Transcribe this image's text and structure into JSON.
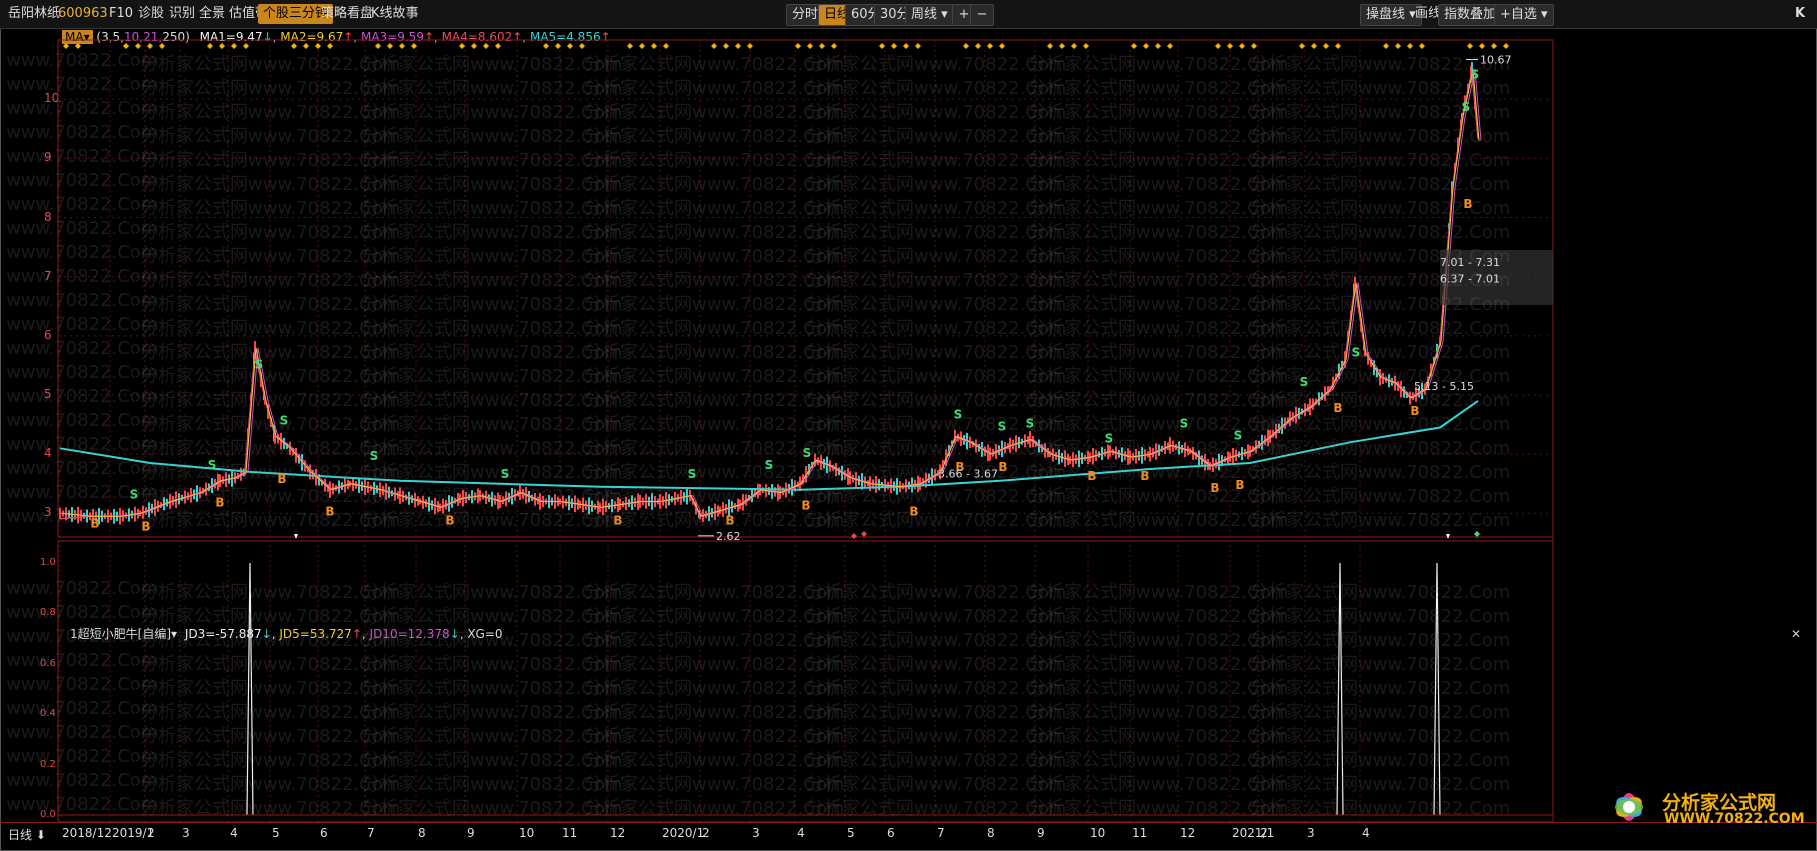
{
  "toolbar": {
    "stock_name": "岳阳林纸",
    "stock_code": "600963",
    "tabs": [
      "F10",
      "诊股",
      "识别",
      "全景",
      "估值带",
      "个股三分钟",
      "策略看盘",
      "K线故事"
    ],
    "active_tab": "个股三分钟",
    "periods": [
      "分时",
      "日线",
      "60分",
      "30分"
    ],
    "active_period": "日线",
    "period_dropdown": "周线",
    "zoom_in": "+",
    "zoom_out": "−",
    "right_buttons": [
      "操盘线",
      "画线",
      "指数叠加",
      "+自选"
    ],
    "k_icon": "K"
  },
  "main_legend": {
    "indicator": "MA",
    "params_prefix": "(3,5,",
    "params_mid": "10,21,",
    "params_suffix": "250)",
    "ma1": "MA1=9.47",
    "ma2": "MA2=9.67",
    "ma3": "MA3=9.59",
    "ma4": "MA4=8.602",
    "ma5": "MA5=4.856"
  },
  "price_labels": {
    "high": "10.67",
    "low": "2.62",
    "zone1_a": "7.01 - 7.31",
    "zone1_b": "6.37 - 7.01",
    "zone2": "5.13 - 5.15",
    "zone3": "3.66 - 3.67"
  },
  "y_axis": [
    "10",
    "9",
    "8",
    "7",
    "6",
    "5",
    "4",
    "3"
  ],
  "sub_legend": {
    "name": "1超短小肥牛[自编]",
    "jd3": "JD3=-57.887",
    "jd5": "JD5=53.727",
    "jd10": "JD10=12.378",
    "xg": "XG=0"
  },
  "sub_y_axis": [
    "1.0",
    "0.8",
    "0.6",
    "0.4",
    "0.2",
    "0.0"
  ],
  "bottom": {
    "period_label": "日线",
    "months": [
      "2018/12",
      "2019/1",
      "2",
      "3",
      "4",
      "5",
      "6",
      "7",
      "8",
      "9",
      "10",
      "11",
      "12",
      "2020/1",
      "2",
      "3",
      "4",
      "5",
      "6",
      "7",
      "8",
      "9",
      "10",
      "11",
      "12",
      "2021/1",
      "2",
      "3",
      "4"
    ]
  },
  "watermark": {
    "text_a": "www.70822.Com",
    "text_b": "分析家公式网www.70822.Com"
  },
  "logo": {
    "cn": "分析家公式网",
    "url": "WWW.70822.COM"
  },
  "signals": {
    "buy": "B",
    "sell": "S"
  },
  "colors": {
    "ma1": "#f0f0f0",
    "ma2": "#f0d030",
    "ma3": "#d050d0",
    "ma4": "#e84a5f",
    "ma5": "#34d6d6",
    "up": "#ff4444",
    "down": "#34d6d6",
    "grid": "#5a0f0f"
  }
}
